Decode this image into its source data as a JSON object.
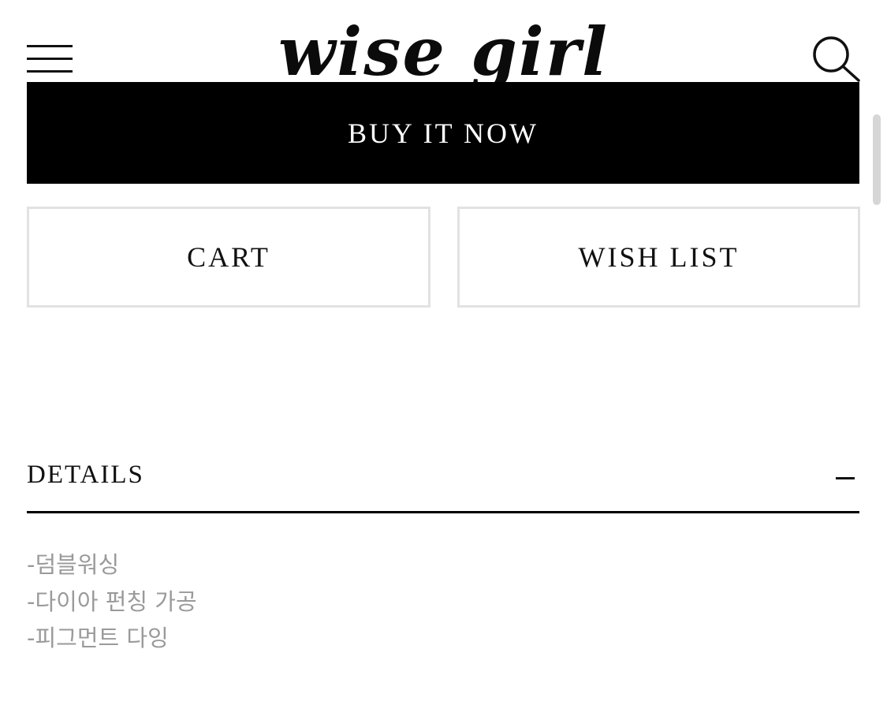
{
  "header": {
    "logo_text": "wise girl",
    "menu_icon": "hamburger-menu-icon",
    "search_icon": "search-icon"
  },
  "actions": {
    "buy_now_label": "BUY IT NOW",
    "cart_label": "CART",
    "wishlist_label": "WISH LIST"
  },
  "details": {
    "title": "DETAILS",
    "toggle_icon": "minus-icon",
    "items": [
      "-덤블워싱",
      "-다이아 펀칭 가공",
      "-피그먼트 다잉"
    ]
  },
  "colors": {
    "primary": "#000000",
    "background": "#ffffff",
    "border": "#e2e2e2",
    "muted_text": "#9a9a9a"
  }
}
